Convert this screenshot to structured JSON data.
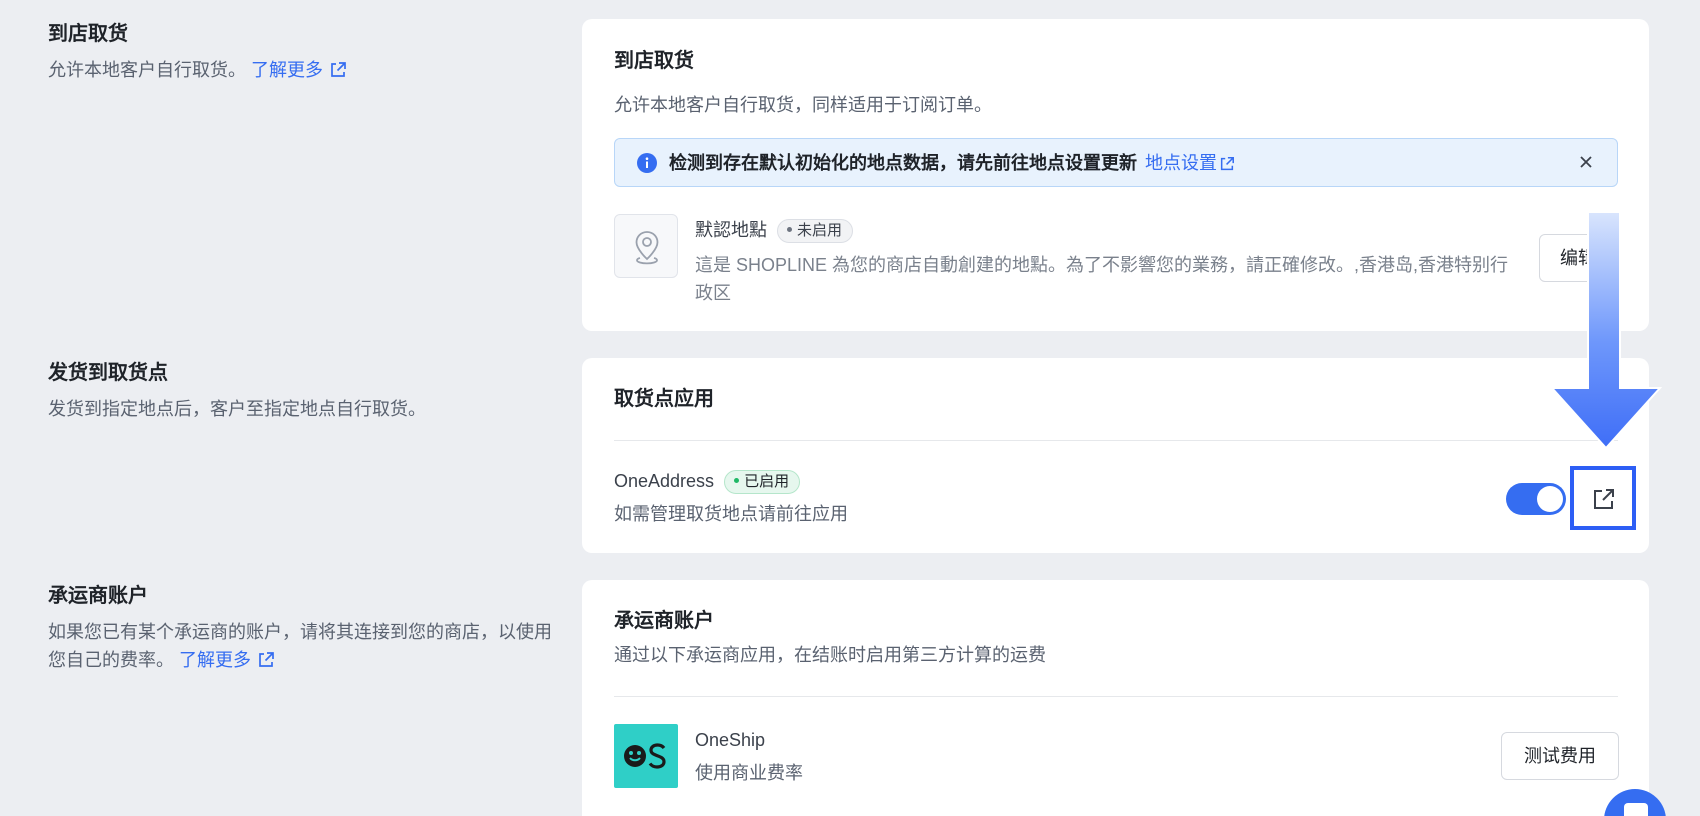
{
  "sections": {
    "pickup": {
      "title": "到店取货",
      "desc": "允许本地客户自行取货。",
      "learn_more": "了解更多"
    },
    "ship_to_pickup": {
      "title": "发货到取货点",
      "desc": "发货到指定地点后，客户至指定地点自行取货。"
    },
    "carrier": {
      "title": "承运商账户",
      "desc": "如果您已有某个承运商的账户，请将其连接到您的商店，以使用您自己的费率。",
      "learn_more": "了解更多"
    }
  },
  "pickup_card": {
    "title": "到店取货",
    "subtitle": "允许本地客户自行取货，同样适用于订阅订单。",
    "alert": {
      "text": "检测到存在默认初始化的地点数据，请先前往地点设置更新",
      "link": "地点设置"
    },
    "location": {
      "name": "默認地點",
      "status": "未启用",
      "desc": "這是 SHOPLINE 為您的商店自動創建的地點。為了不影響您的業務，請正確修改。,香港岛,香港特别行政区",
      "edit_label": "编辑"
    }
  },
  "pickup_app_card": {
    "title": "取货点应用",
    "app": {
      "name": "OneAddress",
      "status": "已启用",
      "desc": "如需管理取货地点请前往应用",
      "enabled": true
    }
  },
  "carrier_card": {
    "title": "承运商账户",
    "subtitle": "通过以下承运商应用，在结账时启用第三方计算的运费",
    "app": {
      "name": "OneShip",
      "desc": "使用商业费率",
      "test_label": "测试费用"
    }
  },
  "colors": {
    "accent": "#356df1",
    "enabled_green": "#1fb866",
    "oneship_teal": "#2fcfc7"
  }
}
